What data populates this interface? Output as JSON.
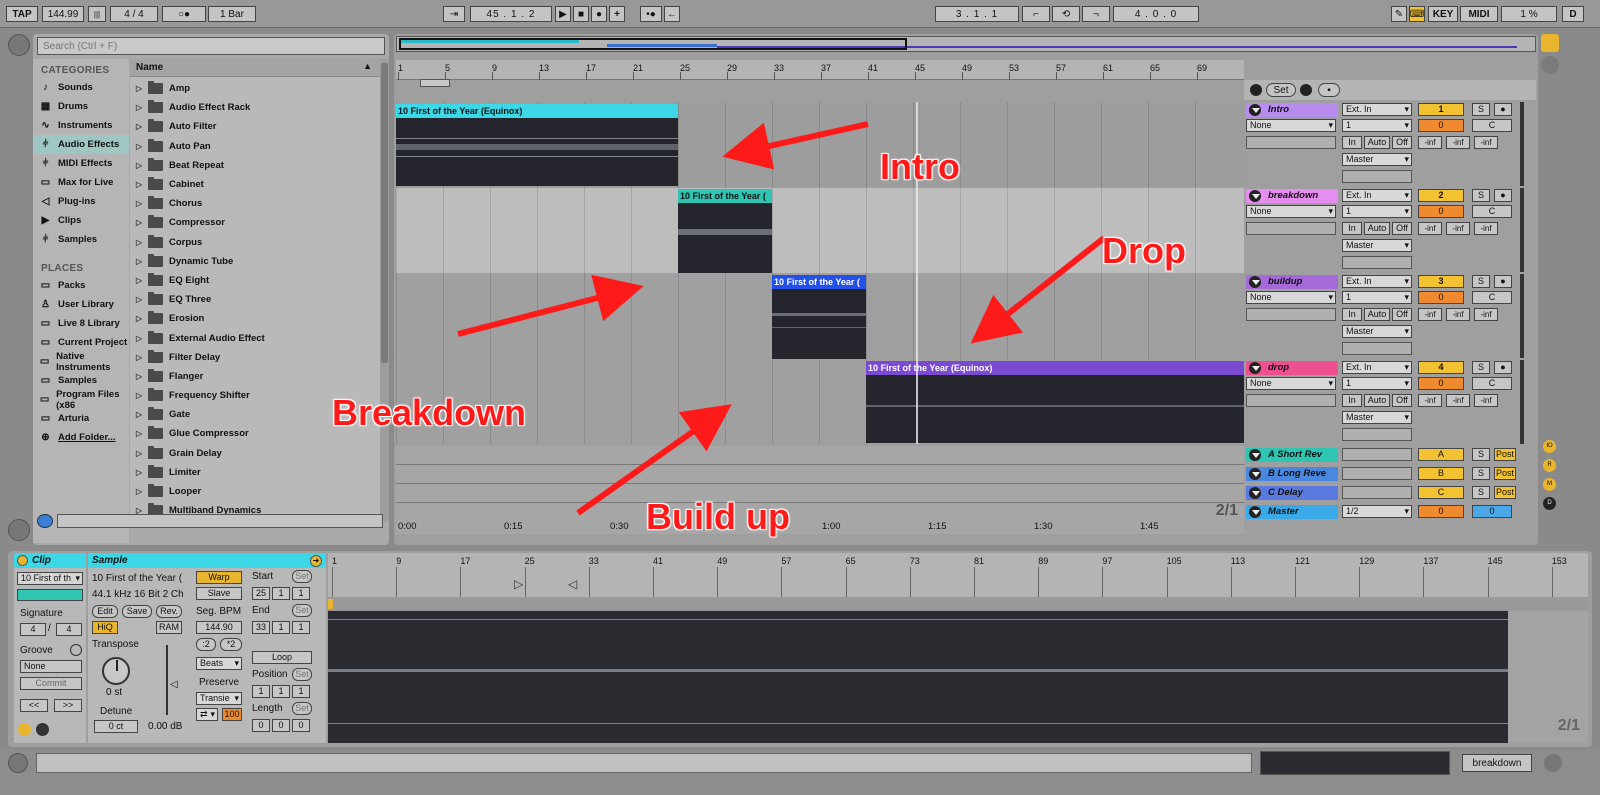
{
  "topbar": {
    "tap": "TAP",
    "tempo": "144.99",
    "signature": "4 / 4",
    "metro": "○●",
    "quantize": "1 Bar",
    "position": "45 .  1 .  2",
    "loop_start": "3 .  1 .  1",
    "loop_length": "4 .  0 .  0",
    "key": "KEY",
    "midi": "MIDI",
    "cpu": "1 %",
    "d": "D"
  },
  "browser": {
    "search_placeholder": "Search (Ctrl + F)",
    "categories_label": "CATEGORIES",
    "categories": [
      {
        "label": "Sounds",
        "icon": "note-icon",
        "glyph": "♪"
      },
      {
        "label": "Drums",
        "icon": "drums-icon",
        "glyph": "▦"
      },
      {
        "label": "Instruments",
        "icon": "instruments-icon",
        "glyph": "∿"
      },
      {
        "label": "Audio Effects",
        "icon": "audio-effects-icon",
        "glyph": "⫩"
      },
      {
        "label": "MIDI Effects",
        "icon": "midi-effects-icon",
        "glyph": "⫩"
      },
      {
        "label": "Max for Live",
        "icon": "max-icon",
        "glyph": "▭"
      },
      {
        "label": "Plug-ins",
        "icon": "plugins-icon",
        "glyph": "◁"
      },
      {
        "label": "Clips",
        "icon": "clips-icon",
        "glyph": "▶"
      },
      {
        "label": "Samples",
        "icon": "samples-icon",
        "glyph": "⫩"
      }
    ],
    "places_label": "PLACES",
    "places": [
      {
        "label": "Packs",
        "glyph": "▭"
      },
      {
        "label": "User Library",
        "glyph": "♙"
      },
      {
        "label": "Live 8 Library",
        "glyph": "▭"
      },
      {
        "label": "Current Project",
        "glyph": "▭"
      },
      {
        "label": "Native Instruments",
        "glyph": "▭"
      },
      {
        "label": "Samples",
        "glyph": "▭"
      },
      {
        "label": "Program Files (x86",
        "glyph": "▭"
      },
      {
        "label": "Arturia",
        "glyph": "▭"
      },
      {
        "label": "Add Folder...",
        "glyph": "⊕"
      }
    ],
    "column_header": "Name",
    "items": [
      "Amp",
      "Audio Effect Rack",
      "Auto Filter",
      "Auto Pan",
      "Beat Repeat",
      "Cabinet",
      "Chorus",
      "Compressor",
      "Corpus",
      "Dynamic Tube",
      "EQ Eight",
      "EQ Three",
      "Erosion",
      "External Audio Effect",
      "Filter Delay",
      "Flanger",
      "Frequency Shifter",
      "Gate",
      "Glue Compressor",
      "Grain Delay",
      "Limiter",
      "Looper",
      "Multiband Dynamics"
    ]
  },
  "arrangement": {
    "bars": [
      "1",
      "5",
      "9",
      "13",
      "17",
      "21",
      "25",
      "29",
      "33",
      "37",
      "41",
      "45",
      "49",
      "53",
      "57",
      "61",
      "65",
      "69"
    ],
    "times": [
      "0:00",
      "0:15",
      "0:30",
      "0:45",
      "1:00",
      "1:15",
      "1:30",
      "1:45"
    ],
    "set_label": "Set",
    "page": "2/1",
    "clip_name": "10 First of the Year (Equinox)",
    "clip_name_short": "10 First of the Year (",
    "tracks": [
      {
        "name": "Intro",
        "color": "#b98cf0",
        "input": "Ext. In",
        "input_sub": "1",
        "monitor_in": "In",
        "monitor_auto": "Auto",
        "monitor_off": "Off",
        "output": "Master",
        "number": "1",
        "pan": "0",
        "pan_side": "C",
        "solo": "S",
        "route": "None"
      },
      {
        "name": "breakdown",
        "color": "#e68ef0",
        "input": "Ext. In",
        "input_sub": "1",
        "monitor_in": "In",
        "monitor_auto": "Auto",
        "monitor_off": "Off",
        "output": "Master",
        "number": "2",
        "pan": "0",
        "pan_side": "C",
        "solo": "S",
        "route": "None"
      },
      {
        "name": "buildup",
        "color": "#a56ad8",
        "input": "Ext. In",
        "input_sub": "1",
        "monitor_in": "In",
        "monitor_auto": "Auto",
        "monitor_off": "Off",
        "output": "Master",
        "number": "3",
        "pan": "0",
        "pan_side": "C",
        "solo": "S",
        "route": "None"
      },
      {
        "name": "drop",
        "color": "#ee4f8e",
        "input": "Ext. In",
        "input_sub": "1",
        "monitor_in": "In",
        "monitor_auto": "Auto",
        "monitor_off": "Off",
        "output": "Master",
        "number": "4",
        "pan": "0",
        "pan_side": "C",
        "solo": "S",
        "route": "None"
      }
    ],
    "meter_inf": "-inf",
    "returns": [
      {
        "name": "A Short Rev",
        "letter": "A",
        "solo": "S",
        "post": "Post",
        "color": "#2ec6b2"
      },
      {
        "name": "B Long Reve",
        "letter": "B",
        "solo": "S",
        "post": "Post",
        "color": "#4a88e0"
      },
      {
        "name": "C Delay",
        "letter": "C",
        "solo": "S",
        "post": "Post",
        "color": "#5a7ae0"
      },
      {
        "name": "Master",
        "letter": "0",
        "solo": "0",
        "post": "1/2",
        "color": "#3aa9e8"
      }
    ],
    "io_letters": [
      "IO",
      "R",
      "M",
      "D"
    ]
  },
  "annotations": {
    "intro": "Intro",
    "drop": "Drop",
    "breakdown": "Breakdown",
    "buildup": "Build up"
  },
  "clip_view": {
    "clip_title": "Clip",
    "clip_name": "10 First of th",
    "signature_label": "Signature",
    "sig_num": "4",
    "sig_den": "4",
    "groove_label": "Groove",
    "groove_value": "None",
    "commit": "Commit",
    "nav_left": "<<",
    "nav_right": ">>",
    "sample_title": "Sample",
    "sample_name": "10 First of the Year (",
    "sample_info": "44.1 kHz 16 Bit 2 Ch",
    "edit": "Edit",
    "save": "Save",
    "rev": "Rev.",
    "hiq": "HiQ",
    "ram": "RAM",
    "transpose_label": "Transpose",
    "transpose_value": "0 st",
    "detune_label": "Detune",
    "detune_value": "0 ct",
    "gain_value": "0.00 dB",
    "warp": "Warp",
    "slave": "Slave",
    "seg_bpm_label": "Seg. BPM",
    "seg_bpm": "144.90",
    "half": ":2",
    "double": "*2",
    "mode": "Beats",
    "preserve_label": "Preserve",
    "preserve": "Transie",
    "loop_glyph": "⇄",
    "hundred": "100",
    "start_label": "Start",
    "start": [
      "25",
      "1",
      "1"
    ],
    "end_label": "End",
    "end": [
      "33",
      "1",
      "1"
    ],
    "loop": "Loop",
    "position_label": "Position",
    "position": [
      "1",
      "1",
      "1"
    ],
    "length_label": "Length",
    "length": [
      "0",
      "0",
      "0"
    ],
    "set": "Set",
    "bars": [
      "1",
      "9",
      "17",
      "25",
      "33",
      "41",
      "49",
      "57",
      "65",
      "73",
      "81",
      "89",
      "97",
      "105",
      "113",
      "121",
      "129",
      "137",
      "145",
      "153"
    ],
    "page": "2/1"
  },
  "statusbar": {
    "track": "breakdown"
  }
}
